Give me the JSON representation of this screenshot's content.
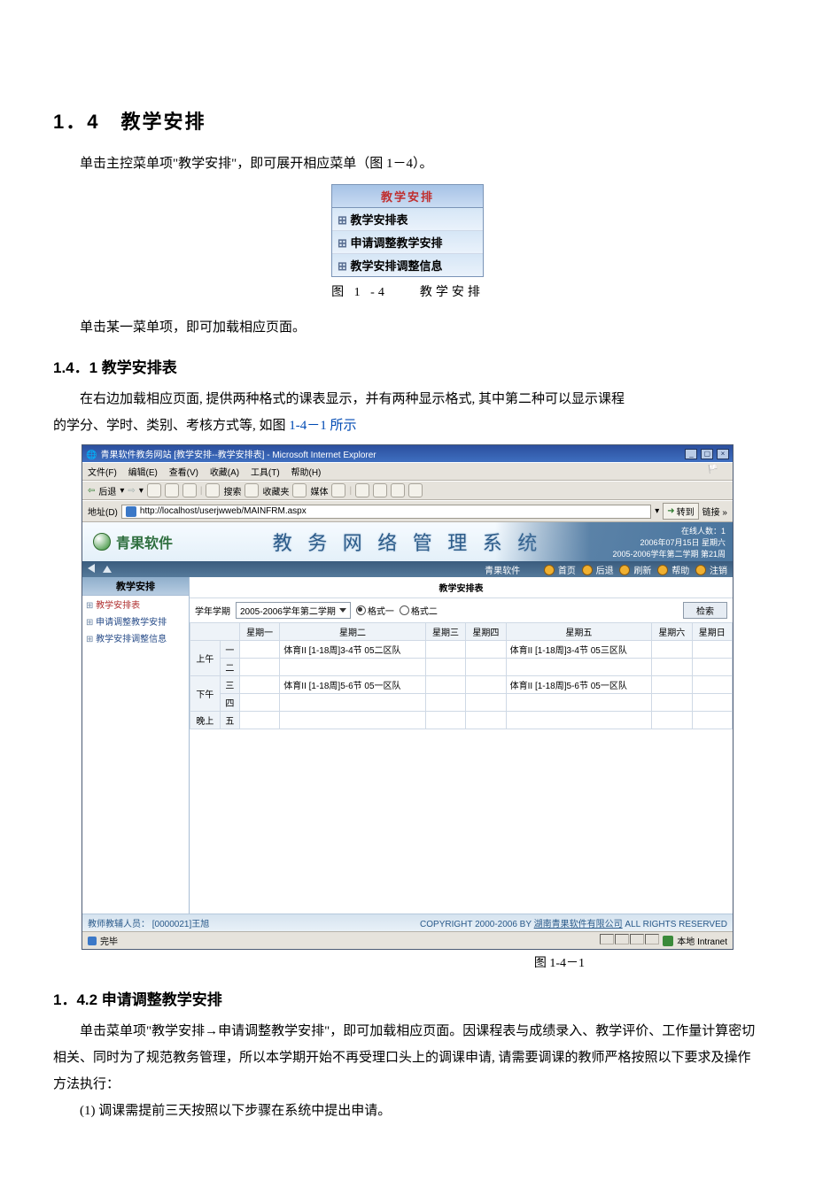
{
  "doc": {
    "h1": "1．4　教学安排",
    "p1": "单击主控菜单项\"教学安排\"，即可展开相应菜单（图 1－4）。",
    "menu": {
      "title": "教学安排",
      "items": [
        "教学安排表",
        "申请调整教学安排",
        "教学安排调整信息"
      ]
    },
    "cap_menu": "图 1 -4　　教学安排",
    "p2": "单击某一菜单项，即可加载相应页面。",
    "h2a": "1.4．1 教学安排表",
    "p3a": "在右边加载相应页面, 提供两种格式的课表显示，并有两种显示格式, 其中第二种可以显示课程",
    "p3b": "的学分、学时、类别、考核方式等, 如图 ",
    "p3b_link": "1-4－1 所示",
    "cap_shot": "图 1-4－1",
    "h2b": "1．4.2 申请调整教学安排",
    "p4": "单击菜单项\"教学安排→申请调整教学安排\"，即可加载相应页面。因课程表与成绩录入、教学评价、工作量计算密切相关、同时为了规范教务管理，所以本学期开始不再受理口头上的调课申请, 请需要调课的教师严格按照以下要求及操作方法执行：",
    "p5": "(1) 调课需提前三天按照以下步骤在系统中提出申请。"
  },
  "browser": {
    "title": "青果软件教务网站 [教学安排--教学安排表] - Microsoft Internet Explorer",
    "menubar": [
      "文件(F)",
      "编辑(E)",
      "查看(V)",
      "收藏(A)",
      "工具(T)",
      "帮助(H)"
    ],
    "back": "后退",
    "toolbar": [
      "搜索",
      "收藏夹",
      "媒体"
    ],
    "addr_label": "地址(D)",
    "url": "http://localhost/userjwweb/MAINFRM.aspx",
    "goto": "转到",
    "links": "链接",
    "status_done": "完毕",
    "zone": "本地 Intranet"
  },
  "app": {
    "logo_text": "青果软件",
    "title": "教 务 网 络 管 理 系 统",
    "online": "在线人数：1",
    "date": "2006年07月15日 星期六",
    "term": "2005-2006学年第二学期 第21周",
    "company": "青果软件",
    "nav": [
      "首页",
      "后退",
      "刷新",
      "帮助",
      "注销"
    ],
    "side_title": "教学安排",
    "side_items": [
      "教学安排表",
      "申请调整教学安排",
      "教学安排调整信息"
    ],
    "content_title": "教学安排表",
    "year_label": "学年学期",
    "year_value": "2005-2006学年第二学期",
    "format1": "格式一",
    "format2": "格式二",
    "search": "检索",
    "days": [
      "星期一",
      "星期二",
      "星期三",
      "星期四",
      "星期五",
      "星期六",
      "星期日"
    ],
    "sessions": {
      "am": "上午",
      "pm": "下午",
      "ev": "晚上",
      "s": [
        "一",
        "二",
        "三",
        "四",
        "五"
      ]
    },
    "cells": {
      "tue_1": "体育II [1-18周]3-4节 05二区队",
      "tue_3": "体育II [1-18周]5-6节 05一区队",
      "fri_1": "体育II [1-18周]3-4节 05三区队",
      "fri_3": "体育II [1-18周]5-6节 05一区队"
    },
    "footer_user_label": "教师教辅人员：",
    "footer_user": "[0000021]王旭",
    "copyright_a": "COPYRIGHT 2000-2006 BY ",
    "copyright_link": "湖南青果软件有限公司",
    "copyright_b": " ALL RIGHTS RESERVED"
  }
}
